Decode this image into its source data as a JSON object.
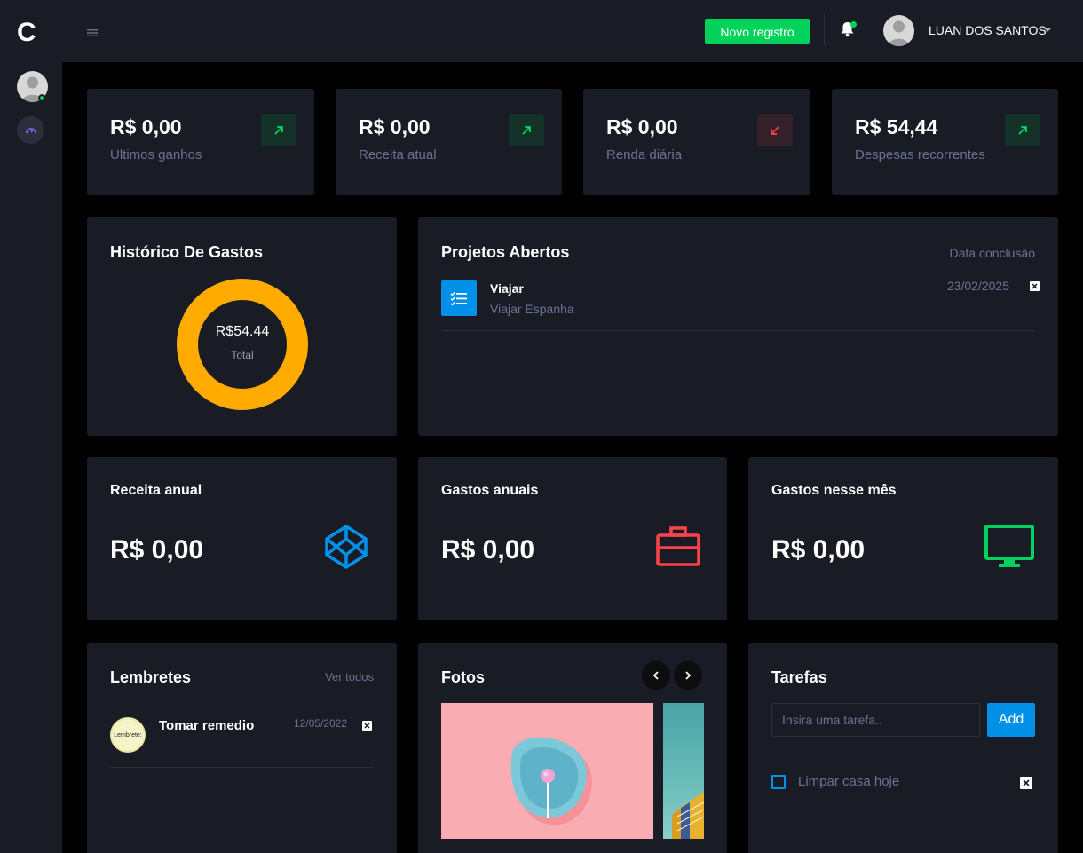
{
  "brand": {
    "logo_letter": "C"
  },
  "topbar": {
    "new_button_label": "Novo registro",
    "user_name": "LUAN DOS SANTOS"
  },
  "stats": [
    {
      "value": "R$ 0,00",
      "label": "Ultimos ganhos",
      "trend": "up",
      "trend_color": "#00d25b"
    },
    {
      "value": "R$ 0,00",
      "label": "Receita atual",
      "trend": "up",
      "trend_color": "#00d25b"
    },
    {
      "value": "R$ 0,00",
      "label": "Renda diária",
      "trend": "down",
      "trend_color": "#fc424a"
    },
    {
      "value": "R$ 54,44",
      "label": "Despesas recorrentes",
      "trend": "up",
      "trend_color": "#00d25b"
    }
  ],
  "history": {
    "title": "Histórico De Gastos",
    "total_value": "R$54.44",
    "total_label": "Total",
    "ring_color": "#ffab00"
  },
  "projects": {
    "title": "Projetos Abertos",
    "date_header": "Data conclusão",
    "items": [
      {
        "name": "Viajar",
        "subtitle": "Viajar Espanha",
        "date": "23/02/2025"
      }
    ]
  },
  "annual_revenue": {
    "title": "Receita anual",
    "value": "R$ 0,00",
    "icon_color": "#0090e7"
  },
  "annual_expenses": {
    "title": "Gastos anuais",
    "value": "R$ 0,00",
    "icon_color": "#fc424a"
  },
  "month_expenses": {
    "title": "Gastos nesse mês",
    "value": "R$ 0,00",
    "icon_color": "#00d25b"
  },
  "reminders": {
    "title": "Lembretes",
    "view_all": "Ver todos",
    "items": [
      {
        "name": "Tomar remedio",
        "date": "12/05/2022",
        "avatar_text": "Lembrete:"
      }
    ]
  },
  "photos": {
    "title": "Fotos"
  },
  "tasks": {
    "title": "Tarefas",
    "input_placeholder": "Insira uma tarefa..",
    "add_label": "Add",
    "items": [
      {
        "text": "Limpar casa hoje",
        "checked": false
      }
    ]
  }
}
